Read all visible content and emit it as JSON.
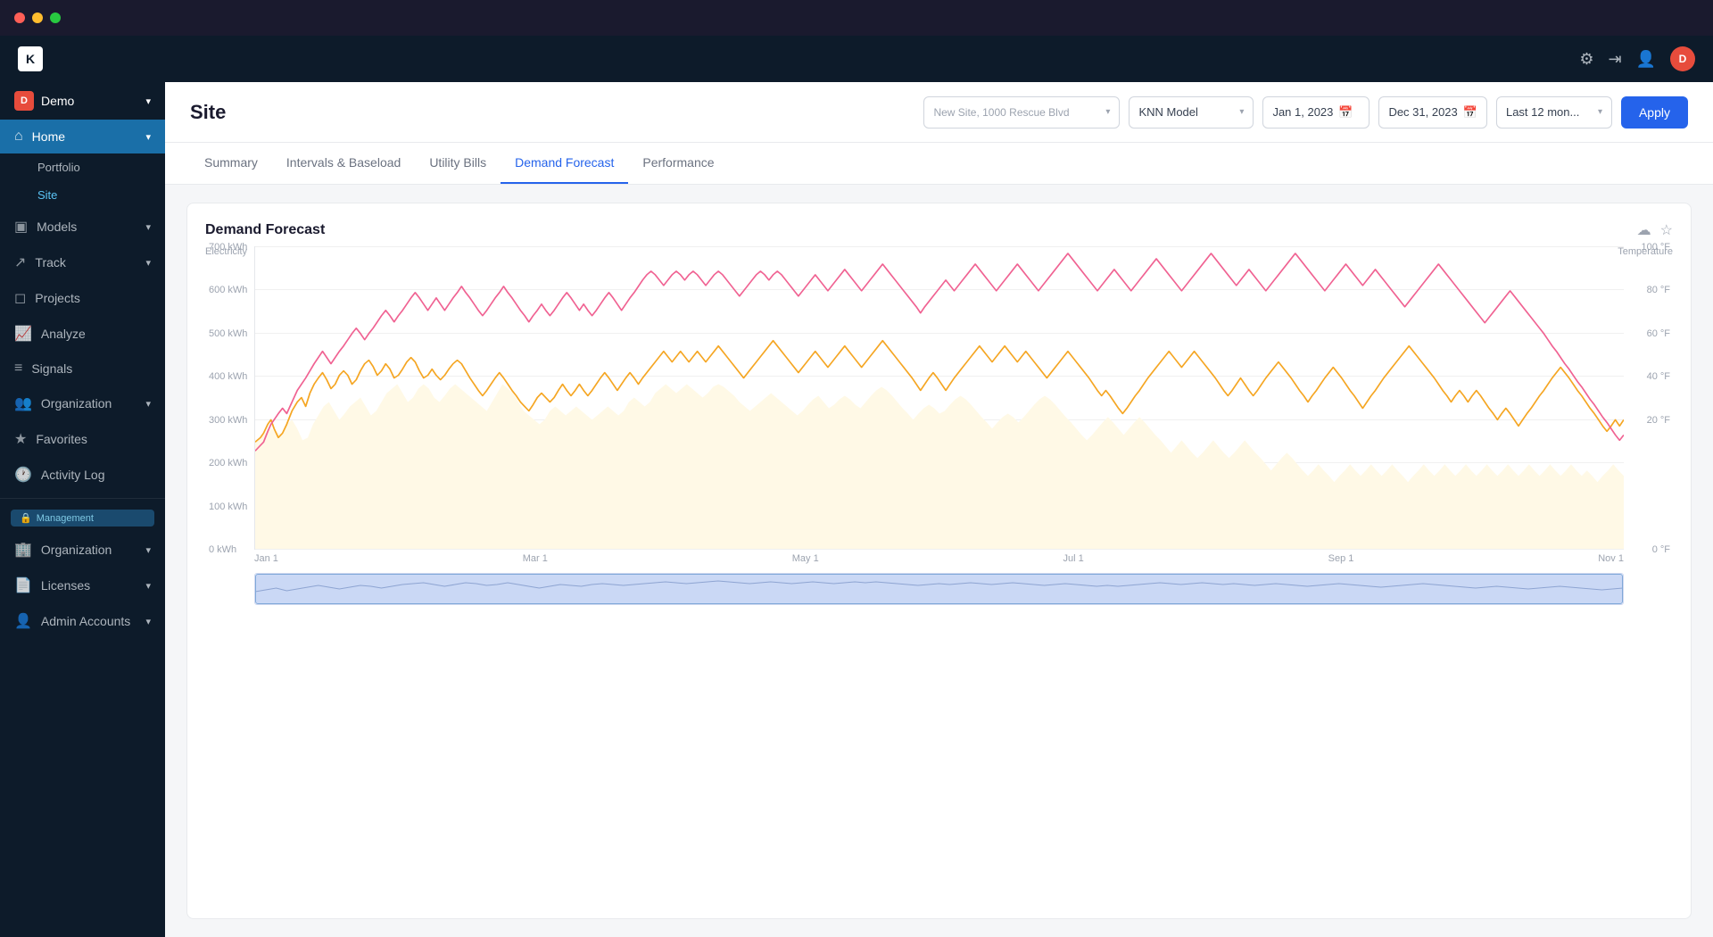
{
  "titlebar": {
    "dots": [
      "red",
      "yellow",
      "green"
    ]
  },
  "topnav": {
    "logo_text": "K",
    "icons": [
      "gear-icon",
      "exit-icon",
      "user-icon"
    ],
    "avatar_text": "D"
  },
  "sidebar": {
    "org": {
      "icon_text": "D",
      "label": "Demo",
      "chevron": "▾"
    },
    "items": [
      {
        "id": "home",
        "label": "Home",
        "icon": "⌂",
        "active": true,
        "expandable": true
      },
      {
        "id": "portfolio",
        "label": "Portfolio",
        "sub": true
      },
      {
        "id": "site",
        "label": "Site",
        "sub": true,
        "active": true
      },
      {
        "id": "models",
        "label": "Models",
        "icon": "◫",
        "expandable": true
      },
      {
        "id": "track",
        "label": "Track",
        "icon": "↗",
        "expandable": true
      },
      {
        "id": "projects",
        "label": "Projects",
        "icon": "◻"
      },
      {
        "id": "analyze",
        "label": "Analyze",
        "icon": "📈"
      },
      {
        "id": "signals",
        "label": "Signals",
        "icon": "≡"
      },
      {
        "id": "organization",
        "label": "Organization",
        "icon": "👥",
        "expandable": true
      },
      {
        "id": "favorites",
        "label": "Favorites",
        "icon": "★"
      },
      {
        "id": "activity-log",
        "label": "Activity Log",
        "icon": "🕐"
      }
    ],
    "management_label": "Management",
    "management_icon": "🔒",
    "management_items": [
      {
        "id": "organization-mgmt",
        "label": "Organization",
        "icon": "🏢",
        "expandable": true
      },
      {
        "id": "licenses",
        "label": "Licenses",
        "icon": "📄",
        "expandable": true
      },
      {
        "id": "admin-accounts",
        "label": "Admin Accounts",
        "icon": "👤",
        "expandable": true
      }
    ]
  },
  "page": {
    "title": "Site",
    "location_placeholder": "New Site, 1000 Rescue Blvd",
    "model_label": "KNN Model",
    "date_start": "Jan 1, 2023",
    "date_end": "Dec 31, 2023",
    "date_range": "Last 12 mon...",
    "apply_label": "Apply"
  },
  "tabs": [
    {
      "id": "summary",
      "label": "Summary"
    },
    {
      "id": "intervals",
      "label": "Intervals & Baseload"
    },
    {
      "id": "utility-bills",
      "label": "Utility Bills"
    },
    {
      "id": "demand-forecast",
      "label": "Demand Forecast",
      "active": true
    },
    {
      "id": "performance",
      "label": "Performance"
    }
  ],
  "chart": {
    "title": "Demand Forecast",
    "y_axis_label": "Electricity",
    "y_axis_right_label": "Temperature",
    "y_ticks": [
      {
        "value": "700 kWh",
        "pct": 0
      },
      {
        "value": "600 kWh",
        "pct": 14
      },
      {
        "value": "500 kWh",
        "pct": 29
      },
      {
        "value": "400 kWh",
        "pct": 43
      },
      {
        "value": "300 kWh",
        "pct": 57
      },
      {
        "value": "200 kWh",
        "pct": 71
      },
      {
        "value": "100 kWh",
        "pct": 85
      },
      {
        "value": "0 kWh",
        "pct": 100
      }
    ],
    "y_ticks_right": [
      {
        "value": "100 °F",
        "pct": 0
      },
      {
        "value": "80 °F",
        "pct": 20
      },
      {
        "value": "60 °F",
        "pct": 40
      },
      {
        "value": "40 °F",
        "pct": 60
      },
      {
        "value": "20 °F",
        "pct": 80
      },
      {
        "value": "0 °F",
        "pct": 100
      }
    ],
    "x_labels": [
      "Jan 1",
      "Mar 1",
      "May 1",
      "Jul 1",
      "Sep 1",
      "Nov 1"
    ],
    "colors": {
      "actual": "#f5a623",
      "forecast": "#f06292",
      "background": "#fffbf0"
    }
  }
}
